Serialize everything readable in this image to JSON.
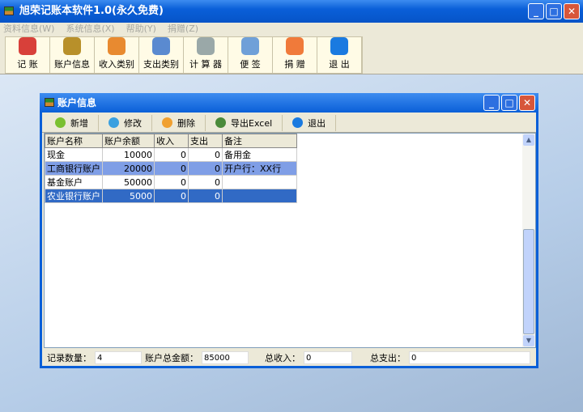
{
  "app": {
    "title": "旭荣记账本软件1.0(永久免费)"
  },
  "menu": [
    "资料信息(W)",
    "系统信息(X)",
    "帮助(Y)",
    "捐赠(Z)"
  ],
  "toolbar": [
    {
      "label": "记 账",
      "icon": "bookkeeping-icon",
      "color": "#d8403a"
    },
    {
      "label": "账户信息",
      "icon": "safe-icon",
      "color": "#b8902a"
    },
    {
      "label": "收入类别",
      "icon": "income-note-icon",
      "color": "#e88a30"
    },
    {
      "label": "支出类别",
      "icon": "expense-note-icon",
      "color": "#5a8ad0"
    },
    {
      "label": "计 算 器",
      "icon": "calculator-icon",
      "color": "#9aa8a8"
    },
    {
      "label": "便 签",
      "icon": "memo-icon",
      "color": "#6fa0d8"
    },
    {
      "label": "捐 赠",
      "icon": "heart-icon",
      "color": "#f07a3a"
    },
    {
      "label": "退 出",
      "icon": "exit-person-icon",
      "color": "#1a7ae0"
    }
  ],
  "child": {
    "title": "账户信息",
    "buttons": [
      {
        "label": "新增",
        "icon": "add-icon",
        "color": "#7ac030"
      },
      {
        "label": "修改",
        "icon": "edit-icon",
        "color": "#3aa0e0"
      },
      {
        "label": "删除",
        "icon": "delete-icon",
        "color": "#f0a030"
      },
      {
        "label": "导出Excel",
        "icon": "export-arrow-icon",
        "color": "#4a8a3a"
      },
      {
        "label": "退出",
        "icon": "exit-person-icon",
        "color": "#1a7ae0"
      }
    ],
    "columns": [
      "账户名称",
      "账户余额",
      "收入",
      "支出",
      "备注"
    ],
    "rows": [
      [
        "现金",
        "10000",
        "0",
        "0",
        "备用金"
      ],
      [
        "工商银行账户",
        "20000",
        "0",
        "0",
        "开户行：XX行"
      ],
      [
        "基金账户",
        "50000",
        "0",
        "0",
        ""
      ],
      [
        "农业银行账户",
        "5000",
        "0",
        "0",
        ""
      ]
    ],
    "status": {
      "count_label": "记录数量：",
      "count": "4",
      "total_label": "账户总金额：",
      "total": "85000",
      "income_label": "总收入：",
      "income": "0",
      "expense_label": "总支出：",
      "expense": "0"
    }
  }
}
